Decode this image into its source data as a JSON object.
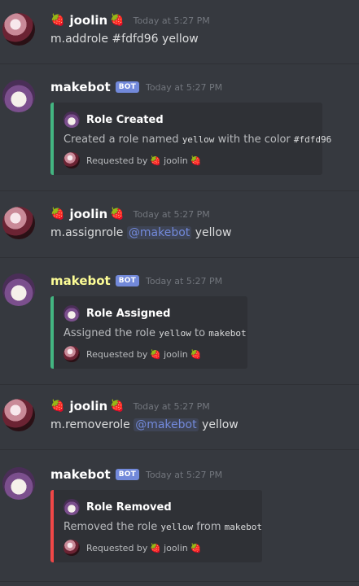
{
  "messages": [
    {
      "author": "joolin",
      "emoji": "🍓",
      "timestamp": "Today at 5:27 PM",
      "text": "m.addrole #fdfd96 yellow"
    },
    {
      "author": "makebot",
      "bot_tag": "BOT",
      "timestamp": "Today at 5:27 PM",
      "embed": {
        "title": "Role Created",
        "desc_pre": "Created a role named ",
        "desc_code1": "yellow",
        "desc_mid": " with the color ",
        "desc_code2": "#fdfd96",
        "footer_prefix": "Requested by",
        "footer_user": "joolin",
        "footer_emoji": "🍓",
        "accent": "#43b581"
      }
    },
    {
      "author": "joolin",
      "emoji": "🍓",
      "timestamp": "Today at 5:27 PM",
      "text_pre": "m.assignrole ",
      "mention": "@makebot",
      "text_post": " yellow"
    },
    {
      "author": "makebot",
      "author_color": "#fdfd96",
      "bot_tag": "BOT",
      "timestamp": "Today at 5:27 PM",
      "embed": {
        "title": "Role Assigned",
        "desc_pre": "Assigned the role ",
        "desc_code1": "yellow",
        "desc_mid": " to ",
        "desc_code2": "makebot",
        "footer_prefix": "Requested by",
        "footer_user": "joolin",
        "footer_emoji": "🍓",
        "accent": "#43b581"
      }
    },
    {
      "author": "joolin",
      "emoji": "🍓",
      "timestamp": "Today at 5:27 PM",
      "text_pre": "m.removerole ",
      "mention": "@makebot",
      "text_post": " yellow"
    },
    {
      "author": "makebot",
      "bot_tag": "BOT",
      "timestamp": "Today at 5:27 PM",
      "embed": {
        "title": "Role Removed",
        "desc_pre": "Removed the role ",
        "desc_code1": "yellow",
        "desc_mid": " from ",
        "desc_code2": "makebot",
        "footer_prefix": "Requested by",
        "footer_user": "joolin",
        "footer_emoji": "🍓",
        "accent": "#f04747"
      }
    }
  ]
}
